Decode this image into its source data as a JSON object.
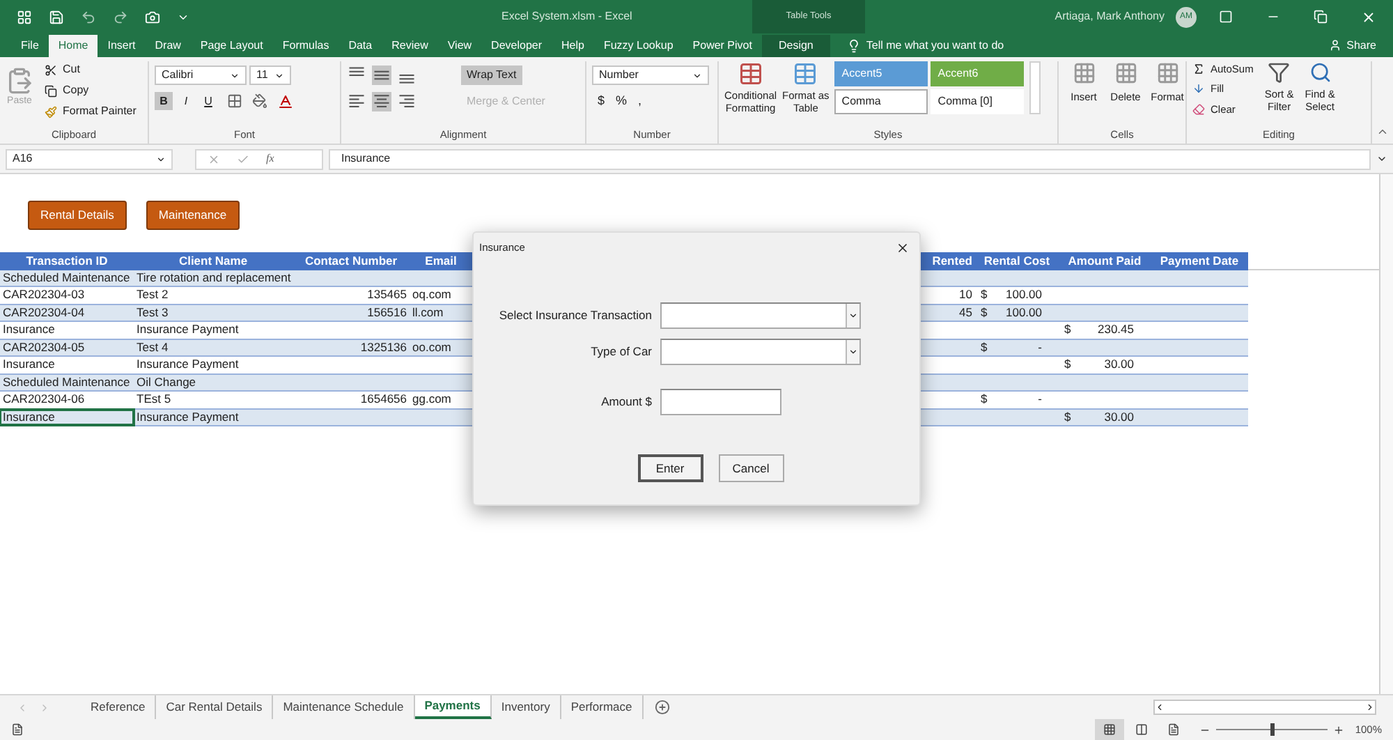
{
  "title_bar": {
    "title": "Excel System.xlsm  -  Excel",
    "context_label": "Table Tools",
    "user": "Artiaga, Mark Anthony",
    "avatar": "AM"
  },
  "ribbon_tabs": [
    {
      "label": "File",
      "selected": false,
      "kind": "normal"
    },
    {
      "label": "Home",
      "selected": true,
      "kind": "normal"
    },
    {
      "label": "Insert",
      "selected": false,
      "kind": "normal"
    },
    {
      "label": "Draw",
      "selected": false,
      "kind": "normal"
    },
    {
      "label": "Page Layout",
      "selected": false,
      "kind": "normal"
    },
    {
      "label": "Formulas",
      "selected": false,
      "kind": "normal"
    },
    {
      "label": "Data",
      "selected": false,
      "kind": "normal"
    },
    {
      "label": "Review",
      "selected": false,
      "kind": "normal"
    },
    {
      "label": "View",
      "selected": false,
      "kind": "normal"
    },
    {
      "label": "Developer",
      "selected": false,
      "kind": "normal"
    },
    {
      "label": "Help",
      "selected": false,
      "kind": "normal"
    },
    {
      "label": "Fuzzy Lookup",
      "selected": false,
      "kind": "normal"
    },
    {
      "label": "Power Pivot",
      "selected": false,
      "kind": "normal"
    },
    {
      "label": "Design",
      "selected": false,
      "kind": "contextual"
    }
  ],
  "tell_me": "Tell me what you want to do",
  "share": "Share",
  "ribbon": {
    "clipboard": {
      "label": "Clipboard",
      "paste": {
        "label": "Paste",
        "disabled": true
      },
      "cut": "Cut",
      "copy": "Copy",
      "format_painter": "Format Painter"
    },
    "font": {
      "label": "Font",
      "name": "Calibri",
      "size": "11",
      "bold": {
        "label": "B",
        "on": true
      },
      "italic": {
        "label": "I",
        "on": false
      },
      "underline": {
        "label": "U",
        "on": false
      }
    },
    "alignment": {
      "label": "Alignment",
      "wrap_text": {
        "label": "Wrap Text",
        "on": true
      },
      "merge": {
        "label": "Merge & Center",
        "disabled": true
      }
    },
    "number": {
      "label": "Number",
      "format": "Number",
      "currency": "$",
      "percent": "%",
      "comma": ","
    },
    "styles": {
      "label": "Styles",
      "conditional": [
        "Conditional",
        "Formatting"
      ],
      "format_table": [
        "Format as",
        "Table"
      ],
      "swatches": [
        {
          "label": "Accent5",
          "color": "#5b9bd5"
        },
        {
          "label": "Accent6",
          "color": "#70ad47"
        },
        {
          "label": "Comma",
          "color": "#ffffff"
        },
        {
          "label": "Comma [0]",
          "color": "#ffffff"
        }
      ]
    },
    "cells": {
      "label": "Cells",
      "buttons": [
        "Insert",
        "Delete",
        "Format"
      ]
    },
    "editing": {
      "label": "Editing",
      "autosum": "AutoSum",
      "fill": "Fill",
      "clear": "Clear",
      "sort": [
        "Sort &",
        "Filter"
      ],
      "find": [
        "Find &",
        "Select"
      ]
    }
  },
  "formula_bar": {
    "name_box": "A16",
    "function_symbol": "fx",
    "value": "Insurance"
  },
  "sheet_buttons": [
    "Rental Details",
    "Maintenance"
  ],
  "table": {
    "columns": [
      "Transaction ID",
      "Client Name",
      "Contact Number",
      "Email",
      "Rented",
      "Rental Cost",
      "Amount Paid",
      "Payment Date"
    ],
    "rows": [
      {
        "transaction_id": "Scheduled Maintenance",
        "client_name": "Tire rotation and replacement",
        "selected": false
      },
      {
        "transaction_id": "CAR202304-03",
        "client_name": "Test 2",
        "contact_number": "135465",
        "email": "oq.com",
        "rented": "10",
        "rental_cost": {
          "symbol": "$",
          "value": "100.00"
        },
        "selected": false
      },
      {
        "transaction_id": "CAR202304-04",
        "client_name": "Test 3",
        "contact_number": "156516",
        "email": "ll.com",
        "rented": "45",
        "rental_cost": {
          "symbol": "$",
          "value": "100.00"
        },
        "selected": false
      },
      {
        "transaction_id": "Insurance",
        "client_name": "Insurance Payment",
        "amount_paid": {
          "symbol": "$",
          "value": "230.45"
        },
        "selected": false
      },
      {
        "transaction_id": "CAR202304-05",
        "client_name": "Test 4",
        "contact_number": "1325136",
        "email": "oo.com",
        "rental_cost": {
          "symbol": "$",
          "value": "-"
        },
        "selected": false
      },
      {
        "transaction_id": "Insurance",
        "client_name": "Insurance Payment",
        "amount_paid": {
          "symbol": "$",
          "value": "30.00"
        },
        "selected": false
      },
      {
        "transaction_id": "Scheduled Maintenance",
        "client_name": "Oil Change",
        "selected": false
      },
      {
        "transaction_id": "CAR202304-06",
        "client_name": "TEst 5",
        "contact_number": "1654656",
        "email": "gg.com",
        "rental_cost": {
          "symbol": "$",
          "value": "-"
        },
        "selected": false
      },
      {
        "transaction_id": "Insurance",
        "client_name": "Insurance Payment",
        "amount_paid": {
          "symbol": "$",
          "value": "30.00"
        },
        "selected": true
      }
    ]
  },
  "dialog": {
    "title": "Insurance",
    "fields": [
      {
        "label": "Select Insurance Transaction",
        "kind": "dropdown"
      },
      {
        "label": "Type of Car",
        "kind": "dropdown"
      },
      {
        "label": "Amount $",
        "kind": "text"
      }
    ],
    "buttons": [
      {
        "label": "Enter",
        "default": true
      },
      {
        "label": "Cancel",
        "default": false
      }
    ]
  },
  "sheet_tabs": [
    {
      "label": "Reference",
      "selected": false
    },
    {
      "label": "Car Rental Details",
      "selected": false
    },
    {
      "label": "Maintenance Schedule",
      "selected": false
    },
    {
      "label": "Payments",
      "selected": true
    },
    {
      "label": "Inventory",
      "selected": false
    },
    {
      "label": "Performace",
      "selected": false
    }
  ],
  "status_bar": {
    "zoom": "100%",
    "zoom_slider": {
      "level": 0.5
    }
  }
}
